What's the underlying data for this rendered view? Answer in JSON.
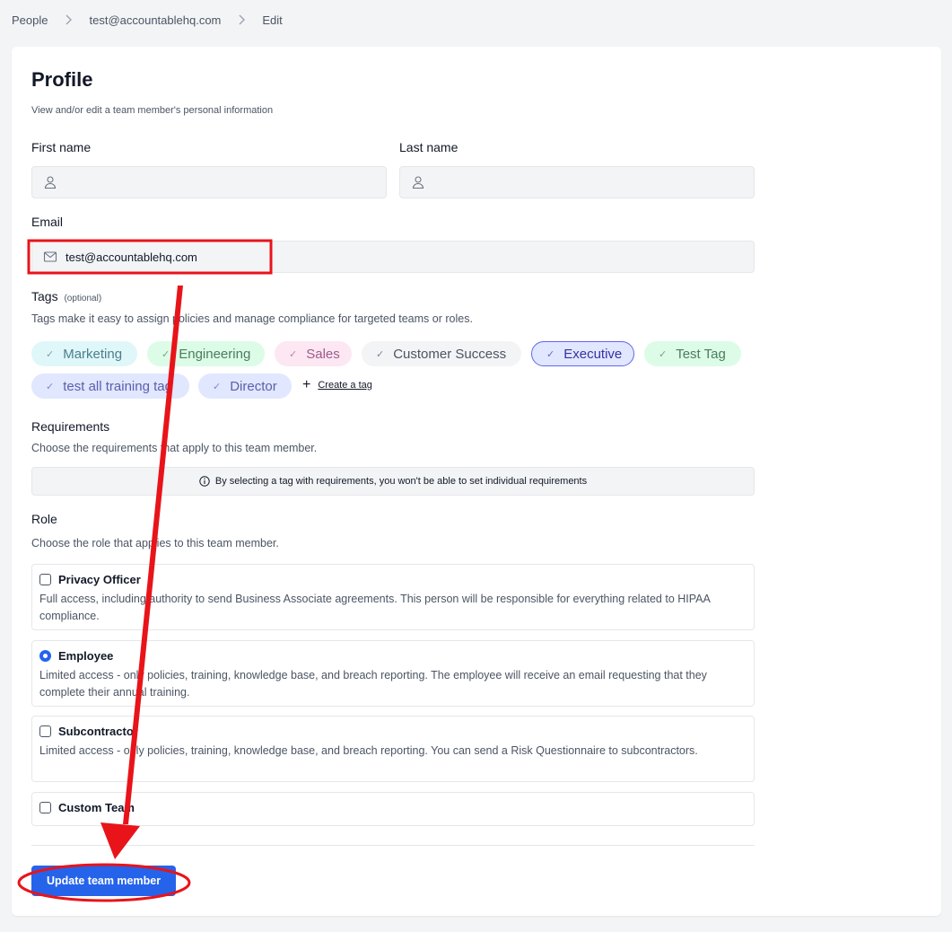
{
  "breadcrumb": {
    "items": [
      "People",
      "test@accountablehq.com",
      "Edit"
    ]
  },
  "profile": {
    "title": "Profile",
    "subtitle": "View and/or edit a team member's personal information"
  },
  "fields": {
    "first_name_label": "First name",
    "first_name_value": "",
    "last_name_label": "Last name",
    "last_name_value": "",
    "email_label": "Email",
    "email_value": "test@accountablehq.com"
  },
  "tags": {
    "label": "Tags",
    "optional": "(optional)",
    "description": "Tags make it easy to assign policies and manage compliance for targeted teams or roles.",
    "items": [
      {
        "label": "Marketing",
        "bg": "#e0f7fa",
        "color": "#4b7f8c"
      },
      {
        "label": "Engineering",
        "bg": "#dcfce7",
        "color": "#4d7c5f"
      },
      {
        "label": "Sales",
        "bg": "#fce7f3",
        "color": "#9d5b8b"
      },
      {
        "label": "Customer Success",
        "bg": "#f3f4f6",
        "color": "#4b5563"
      },
      {
        "label": "Executive",
        "bg": "#e0e7ff",
        "color": "#3730a3",
        "selected": true
      },
      {
        "label": "Test Tag",
        "bg": "#dcfce7",
        "color": "#4d7c5f"
      },
      {
        "label": "test all training tag",
        "bg": "#e0e7ff",
        "color": "#5b5fa8"
      },
      {
        "label": "Director",
        "bg": "#e0e7ff",
        "color": "#5b5fa8"
      }
    ],
    "create_label": "Create a tag"
  },
  "requirements": {
    "label": "Requirements",
    "description": "Choose the requirements that apply to this team member.",
    "notice": "By selecting a tag with requirements, you won't be able to set individual requirements"
  },
  "role": {
    "label": "Role",
    "description": "Choose the role that applies to this team member.",
    "options": [
      {
        "name": "Privacy Officer",
        "description": "Full access, including authority to send Business Associate agreements. This person will be responsible for everything related to HIPAA compliance.",
        "selected": false
      },
      {
        "name": "Employee",
        "description": "Limited access - only policies, training, knowledge base, and breach reporting. The employee will receive an email requesting that they complete their annual training.",
        "selected": true
      },
      {
        "name": "Subcontractor",
        "description": "Limited access - only policies, training, knowledge base, and breach reporting. You can send a Risk Questionnaire to subcontractors.",
        "selected": false
      },
      {
        "name": "Custom Team",
        "description": "",
        "selected": false
      }
    ]
  },
  "actions": {
    "submit_label": "Update team member"
  },
  "colors": {
    "accent": "#2563eb",
    "annotation": "#e8141a"
  }
}
